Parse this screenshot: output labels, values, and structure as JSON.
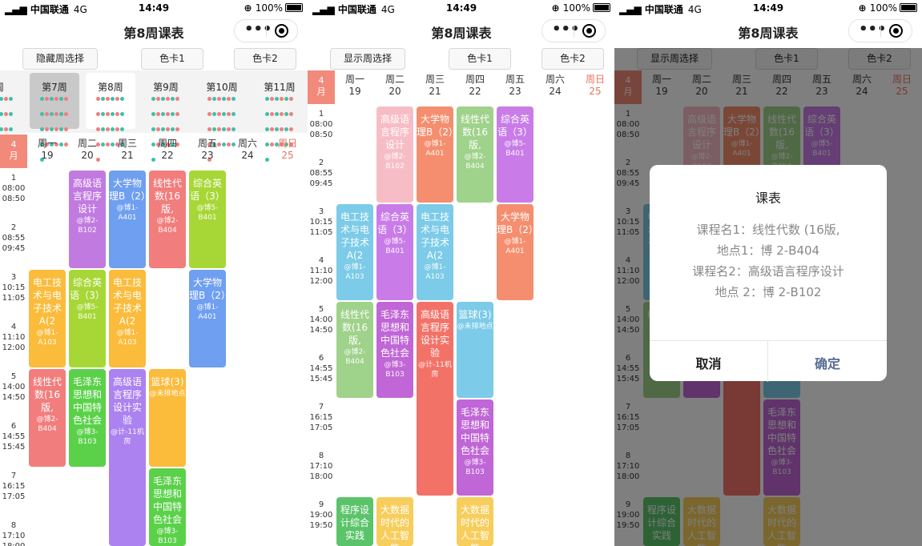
{
  "status": {
    "carrier": "中国联通",
    "network": "4G",
    "time": "14:49",
    "battery": "100%"
  },
  "page": {
    "title": "第8周课表"
  },
  "toolbar": {
    "hide_week": "隐藏周选择",
    "show_week": "显示周选择",
    "color_card_1": "色卡1",
    "color_card_2": "色卡2"
  },
  "weeks": [
    {
      "label": "周"
    },
    {
      "label": "第7周",
      "state": "selected"
    },
    {
      "label": "第8周",
      "state": "current"
    },
    {
      "label": "第9周"
    },
    {
      "label": "第10周"
    },
    {
      "label": "第11周"
    }
  ],
  "month": {
    "num": "4",
    "unit": "月"
  },
  "days": [
    {
      "name": "周一",
      "date": "19"
    },
    {
      "name": "周二",
      "date": "20"
    },
    {
      "name": "周三",
      "date": "21"
    },
    {
      "name": "周四",
      "date": "22"
    },
    {
      "name": "周五",
      "date": "23"
    },
    {
      "name": "周六",
      "date": "24"
    },
    {
      "name": "周日",
      "date": "25",
      "weekend": true
    }
  ],
  "slots": [
    {
      "n": "1",
      "start": "08:00",
      "end": "08:50"
    },
    {
      "n": "2",
      "start": "08:55",
      "end": "09:45"
    },
    {
      "n": "3",
      "start": "10:15",
      "end": "11:05"
    },
    {
      "n": "4",
      "start": "11:10",
      "end": "12:00"
    },
    {
      "n": "5",
      "start": "14:00",
      "end": "14:50"
    },
    {
      "n": "6",
      "start": "14:55",
      "end": "15:45"
    },
    {
      "n": "7",
      "start": "16:15",
      "end": "17:05"
    },
    {
      "n": "8",
      "start": "17:10",
      "end": "18:00"
    },
    {
      "n": "9",
      "start": "19:00",
      "end": "19:50"
    }
  ],
  "courses": [
    {
      "day": 1,
      "start": 1,
      "span": 2,
      "name": "高级语言程序设计",
      "loc": "@博2-B102",
      "color": "#c17ae0"
    },
    {
      "day": 2,
      "start": 1,
      "span": 2,
      "name": "大学物理B（2）",
      "loc": "@博1-A401",
      "color": "#6f9ff0"
    },
    {
      "day": 3,
      "start": 1,
      "span": 2,
      "name": "线性代数(16版,",
      "loc": "@博2-B404",
      "color": "#f27d7d"
    },
    {
      "day": 4,
      "start": 1,
      "span": 2,
      "name": "综合英语（3）",
      "loc": "@博5-B401",
      "color": "#a7d736"
    },
    {
      "day": 0,
      "start": 3,
      "span": 2,
      "name": "电工技术与电子技术A(2",
      "loc": "@博1-A103",
      "color": "#fbbb3b"
    },
    {
      "day": 1,
      "start": 3,
      "span": 2,
      "name": "综合英语（3）",
      "loc": "@博5-B401",
      "color": "#a7d736"
    },
    {
      "day": 2,
      "start": 3,
      "span": 2,
      "name": "电工技术与电子技术A(2",
      "loc": "@博1-A103",
      "color": "#fbbb3b"
    },
    {
      "day": 4,
      "start": 3,
      "span": 2,
      "name": "大学物理B（2）",
      "loc": "@博1-A401",
      "color": "#6f9ff0"
    },
    {
      "day": 0,
      "start": 5,
      "span": 2,
      "name": "线性代数(16版,",
      "loc": "@博2-B404",
      "color": "#f27d7d"
    },
    {
      "day": 1,
      "start": 5,
      "span": 2,
      "name": "毛泽东思想和中国特色社会",
      "loc": "@博3-B103",
      "color": "#5bd14a"
    },
    {
      "day": 2,
      "start": 5,
      "span": 4,
      "name": "高级语言程序设计实验",
      "loc": "@计-11机房",
      "color": "#ac82f0"
    },
    {
      "day": 3,
      "start": 5,
      "span": 2,
      "name": "篮球(3)",
      "loc": "@未排地点",
      "color": "#fbbb3b"
    },
    {
      "day": 3,
      "start": 7,
      "span": 2,
      "name": "毛泽东思想和中国特色社会",
      "loc": "@博3-B103",
      "color": "#5bd14a"
    }
  ],
  "courses_b": [
    {
      "day": 1,
      "start": 1,
      "span": 2,
      "name": "高级语言程序设计",
      "loc": "@博2-B102",
      "color": "#f7bdc6"
    },
    {
      "day": 2,
      "start": 1,
      "span": 2,
      "name": "大学物理B（2）",
      "loc": "@博1-A401",
      "color": "#f58e6e"
    },
    {
      "day": 3,
      "start": 1,
      "span": 2,
      "name": "线性代数(16版,",
      "loc": "@博2-B404",
      "color": "#9fd28a"
    },
    {
      "day": 4,
      "start": 1,
      "span": 2,
      "name": "综合英语（3）",
      "loc": "@博5-B401",
      "color": "#c97ce8"
    },
    {
      "day": 0,
      "start": 3,
      "span": 2,
      "name": "电工技术与电子技术A(2",
      "loc": "@博1-A103",
      "color": "#7ccbe8"
    },
    {
      "day": 1,
      "start": 3,
      "span": 2,
      "name": "综合英语（3）",
      "loc": "@博5-B401",
      "color": "#c97ce8"
    },
    {
      "day": 2,
      "start": 3,
      "span": 2,
      "name": "电工技术与电子技术A(2",
      "loc": "@博1-A103",
      "color": "#7ccbe8"
    },
    {
      "day": 4,
      "start": 3,
      "span": 2,
      "name": "大学物理B（2）",
      "loc": "@博1-A401",
      "color": "#f58e6e"
    },
    {
      "day": 0,
      "start": 5,
      "span": 2,
      "name": "线性代数(16版,",
      "loc": "@博2-B404",
      "color": "#9fd28a"
    },
    {
      "day": 1,
      "start": 5,
      "span": 2,
      "name": "毛泽东思想和中国特色社会",
      "loc": "@博3-B103",
      "color": "#c066d6"
    },
    {
      "day": 2,
      "start": 5,
      "span": 4,
      "name": "高级语言程序设计实验",
      "loc": "@计-11机房",
      "color": "#f37268"
    },
    {
      "day": 3,
      "start": 5,
      "span": 2,
      "name": "篮球(3)",
      "loc": "@未排地点",
      "color": "#7ccbe8"
    },
    {
      "day": 3,
      "start": 7,
      "span": 2,
      "name": "毛泽东思想和中国特色社会",
      "loc": "@博3-B103",
      "color": "#c066d6"
    },
    {
      "day": 0,
      "start": 9,
      "span": 2,
      "name": "程序设计综合实践",
      "loc": "",
      "color": "#5bc46a"
    },
    {
      "day": 1,
      "start": 9,
      "span": 2,
      "name": "大数据时代的人工智能",
      "loc": "",
      "color": "#f7cd5b"
    },
    {
      "day": 3,
      "start": 9,
      "span": 2,
      "name": "大数据时代的人工智能",
      "loc": "",
      "color": "#f7cd5b"
    }
  ],
  "dialog": {
    "title": "课表",
    "line1": "课程名1：线性代数 (16版,",
    "line2": "地点1：博 2-B404",
    "line3": "课程名2：高级语言程序设计",
    "line4": "地点 2：博 2-B102",
    "cancel": "取消",
    "confirm": "确定"
  }
}
